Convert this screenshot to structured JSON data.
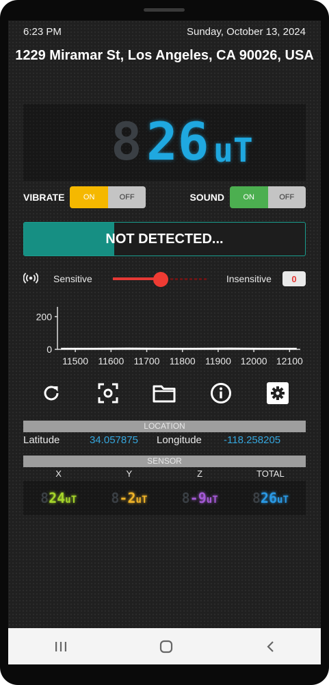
{
  "status": {
    "time": "6:23 PM",
    "date": "Sunday, October 13, 2024"
  },
  "address": "1229 Miramar St, Los Angeles, CA 90026, USA",
  "meter": {
    "inactive_digit": "8",
    "value": "26",
    "unit": "uT",
    "color": "#1fa8e0"
  },
  "vibrate": {
    "label": "VIBRATE",
    "on": "ON",
    "off": "OFF",
    "active_color": "#f5b800"
  },
  "sound": {
    "label": "SOUND",
    "on": "ON",
    "off": "OFF",
    "active_color": "#4caf50"
  },
  "detection": {
    "text": "NOT DETECTED...",
    "progress": 0.32,
    "color": "#168f83"
  },
  "sensitivity": {
    "left_label": "Sensitive",
    "right_label": "Insensitive",
    "value": "0",
    "slider_position": 0.5,
    "icon": "broadcast-icon"
  },
  "chart_data": {
    "type": "line",
    "x_ticks": [
      "11500",
      "11600",
      "11700",
      "11800",
      "11900",
      "12000",
      "12100"
    ],
    "y_ticks": [
      "0",
      "200"
    ],
    "xlim": [
      11450,
      12130
    ],
    "ylim": [
      0,
      260
    ],
    "series": [
      {
        "values": [
          4,
          4,
          5,
          4,
          4,
          5,
          4,
          4
        ]
      }
    ]
  },
  "toolbar": [
    {
      "icon": "refresh-icon"
    },
    {
      "icon": "screenshot-icon"
    },
    {
      "icon": "folder-icon"
    },
    {
      "icon": "info-icon"
    },
    {
      "icon": "settings-icon"
    }
  ],
  "location": {
    "header": "LOCATION",
    "lat_label": "Latitude",
    "lat": "34.057875",
    "lon_label": "Longitude",
    "lon": "-118.258205"
  },
  "sensor": {
    "header": "SENSOR",
    "axes": [
      {
        "label": "X",
        "value": "24",
        "unit": "uT",
        "color": "#a6d62a"
      },
      {
        "label": "Y",
        "value": "-2",
        "unit": "uT",
        "color": "#f0b428"
      },
      {
        "label": "Z",
        "value": "-9",
        "unit": "uT",
        "color": "#a55ad6"
      },
      {
        "label": "TOTAL",
        "value": "26",
        "unit": "uT",
        "color": "#2a9ae6"
      }
    ]
  }
}
